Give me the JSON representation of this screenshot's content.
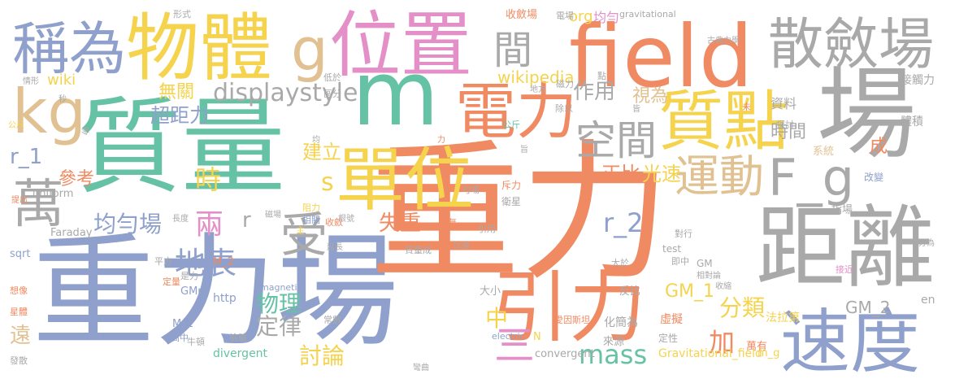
{
  "palette": {
    "salmon": "#f08a62",
    "blue": "#8ea0cb",
    "green": "#66c2a5",
    "yellow": "#f5d34d",
    "pink": "#e48fc7",
    "gray": "#a9a9a9",
    "tan": "#e1c191",
    "lime": "#a6d854"
  },
  "words": [
    {
      "text": "重力場",
      "color": "#8ea0cb"
    },
    {
      "text": "重力",
      "color": "#f08a62"
    },
    {
      "text": "field",
      "color": "#f08a62"
    },
    {
      "text": "質量",
      "color": "#66c2a5"
    },
    {
      "text": "位置",
      "color": "#e48fc7"
    },
    {
      "text": "物體",
      "color": "#f5d34d"
    },
    {
      "text": "稱為",
      "color": "#8ea0cb"
    },
    {
      "text": "m",
      "color": "#66c2a5"
    },
    {
      "text": "單位",
      "color": "#f5d34d"
    },
    {
      "text": "引力",
      "color": "#f08a62"
    },
    {
      "text": "場",
      "color": "#a9a9a9"
    },
    {
      "text": "距離",
      "color": "#a9a9a9"
    },
    {
      "text": "速度",
      "color": "#8ea0cb"
    },
    {
      "text": "散斂場",
      "color": "#a9a9a9"
    },
    {
      "text": "質點",
      "color": "#f5d34d"
    },
    {
      "text": "電力",
      "color": "#f08a62"
    },
    {
      "text": "kg",
      "color": "#e1c191"
    },
    {
      "text": "g",
      "color": "#e1c191"
    },
    {
      "text": "萬",
      "color": "#a9a9a9"
    },
    {
      "text": "間",
      "color": "#a9a9a9"
    },
    {
      "text": "運動",
      "color": "#e1c191"
    },
    {
      "text": "F_g",
      "color": "#a9a9a9"
    },
    {
      "text": "空間",
      "color": "#a9a9a9"
    },
    {
      "text": "受",
      "color": "#a9a9a9"
    },
    {
      "text": "displaystyle",
      "color": "#a9a9a9"
    },
    {
      "text": "作用",
      "color": "#a9a9a9"
    },
    {
      "text": "視為",
      "color": "#e1c191"
    },
    {
      "text": "無關",
      "color": "#f5d34d"
    },
    {
      "text": "超距力",
      "color": "#8ea0cb"
    },
    {
      "text": "時間",
      "color": "#a9a9a9"
    },
    {
      "text": "建立",
      "color": "#f5d34d"
    },
    {
      "text": "均勻場",
      "color": "#8ea0cb"
    },
    {
      "text": "兩",
      "color": "#e48fc7"
    },
    {
      "text": "r",
      "color": "#a9a9a9"
    },
    {
      "text": "s",
      "color": "#f5d34d"
    },
    {
      "text": "失重",
      "color": "#f08a62"
    },
    {
      "text": "正比",
      "color": "#f08a62"
    },
    {
      "text": "光速",
      "color": "#f5d34d"
    },
    {
      "text": "時",
      "color": "#f5d34d"
    },
    {
      "text": "r_2",
      "color": "#8ea0cb"
    },
    {
      "text": "地表",
      "color": "#8ea0cb"
    },
    {
      "text": "物理",
      "color": "#66c2a5"
    },
    {
      "text": "定律",
      "color": "#a9a9a9"
    },
    {
      "text": "分類",
      "color": "#f5d34d"
    },
    {
      "text": "加",
      "color": "#f08a62"
    },
    {
      "text": "三",
      "color": "#e48fc7"
    },
    {
      "text": "中",
      "color": "#f5d34d"
    },
    {
      "text": "討論",
      "color": "#f5d34d"
    },
    {
      "text": "mass",
      "color": "#66c2a5"
    },
    {
      "text": "遠",
      "color": "#e1c191"
    },
    {
      "text": "參考",
      "color": "#f08a62"
    },
    {
      "text": "r_1",
      "color": "#8ea0cb"
    },
    {
      "text": "成",
      "color": "#f08a62"
    },
    {
      "text": "wikipedia",
      "color": "#f5d34d"
    },
    {
      "text": "wiki",
      "color": "#f5d34d"
    },
    {
      "text": "GM_1",
      "color": "#f5d34d"
    },
    {
      "text": "GM_2",
      "color": "#a9a9a9"
    },
    {
      "text": "org",
      "color": "#f5d34d"
    },
    {
      "text": "均勻",
      "color": "#e48fc7"
    },
    {
      "text": "資料",
      "color": "#a9a9a9"
    },
    {
      "text": "接觸力",
      "color": "#a9a9a9"
    },
    {
      "text": "體積",
      "color": "#a9a9a9"
    },
    {
      "text": "系統",
      "color": "#e1c191"
    },
    {
      "text": "指場",
      "color": "#a9a9a9"
    },
    {
      "text": "改變",
      "color": "#8ea0cb"
    },
    {
      "text": "en",
      "color": "#a9a9a9"
    },
    {
      "text": "法拉第",
      "color": "#f5d34d"
    },
    {
      "text": "萬有",
      "color": "#f08a62"
    },
    {
      "text": "虛擬",
      "color": "#f08a62"
    },
    {
      "text": "反比",
      "color": "#a9a9a9"
    },
    {
      "text": "定性",
      "color": "#a9a9a9"
    },
    {
      "text": "來源",
      "color": "#a9a9a9"
    },
    {
      "text": "化簡為",
      "color": "#a9a9a9"
    },
    {
      "text": "大小",
      "color": "#a9a9a9"
    },
    {
      "text": "愛因斯坦",
      "color": "#f08a62"
    },
    {
      "text": "electric",
      "color": "#8ea0cb"
    },
    {
      "text": "N",
      "color": "#f5d34d"
    },
    {
      "text": "convergent",
      "color": "#a9a9a9"
    },
    {
      "text": "Gravitational_field",
      "color": "#f5d34d"
    },
    {
      "text": "m_g",
      "color": "#f5d34d"
    },
    {
      "text": "divergent",
      "color": "#66c2a5"
    },
    {
      "text": "GMm",
      "color": "#8ea0cb"
    },
    {
      "text": "M_1",
      "color": "#8ea0cb"
    },
    {
      "text": "M_2",
      "color": "#f08a62"
    },
    {
      "text": "http",
      "color": "#8ea0cb"
    },
    {
      "text": "magnetic",
      "color": "#8ea0cb"
    },
    {
      "text": "Faraday",
      "color": "#a9a9a9"
    },
    {
      "text": "uniform",
      "color": "#a9a9a9"
    },
    {
      "text": "sqrt",
      "color": "#8ea0cb"
    },
    {
      "text": "test",
      "color": "#a9a9a9"
    },
    {
      "text": "GM",
      "color": "#a9a9a9"
    },
    {
      "text": "gravitational",
      "color": "#a9a9a9"
    },
    {
      "text": "古典力學",
      "color": "#a9a9a9"
    },
    {
      "text": "收斂場",
      "color": "#f08a62"
    },
    {
      "text": "電場",
      "color": "#a9a9a9"
    },
    {
      "text": "形式",
      "color": "#a9a9a9"
    },
    {
      "text": "低於",
      "color": "#a9a9a9"
    },
    {
      "text": "區分",
      "color": "#a9a9a9"
    },
    {
      "text": "磁力",
      "color": "#a9a9a9"
    },
    {
      "text": "地方",
      "color": "#a9a9a9"
    },
    {
      "text": "除以",
      "color": "#a9a9a9"
    },
    {
      "text": "公斤",
      "color": "#66c2a5"
    },
    {
      "text": "皆",
      "color": "#a9a9a9"
    },
    {
      "text": "點",
      "color": "#a9a9a9"
    },
    {
      "text": "未",
      "color": "#f08a62"
    },
    {
      "text": "探討",
      "color": "#a9a9a9"
    },
    {
      "text": "衛星",
      "color": "#a9a9a9"
    },
    {
      "text": "斥力",
      "color": "#f08a62"
    },
    {
      "text": "引用",
      "color": "#a9a9a9"
    },
    {
      "text": "勻場",
      "color": "#a9a9a9"
    },
    {
      "text": "收斂",
      "color": "#f08a62"
    },
    {
      "text": "阻力",
      "color": "#f5d34d"
    },
    {
      "text": "相關",
      "color": "#8ea0cb"
    },
    {
      "text": "主",
      "color": "#f5d34d"
    },
    {
      "text": "磁場",
      "color": "#a9a9a9"
    },
    {
      "text": "根號",
      "color": "#a9a9a9"
    },
    {
      "text": "質量成",
      "color": "#a9a9a9"
    },
    {
      "text": "比值",
      "color": "#a9a9a9"
    },
    {
      "text": "長度",
      "color": "#a9a9a9"
    },
    {
      "text": "延長",
      "color": "#a9a9a9"
    },
    {
      "text": "是力",
      "color": "#a9a9a9"
    },
    {
      "text": "平方",
      "color": "#a9a9a9"
    },
    {
      "text": "定量",
      "color": "#f08a62"
    },
    {
      "text": "大於",
      "color": "#a9a9a9"
    },
    {
      "text": "對行",
      "color": "#a9a9a9"
    },
    {
      "text": "即中",
      "color": "#a9a9a9"
    },
    {
      "text": "相對論",
      "color": "#a9a9a9"
    },
    {
      "text": "收縮",
      "color": "#a9a9a9"
    },
    {
      "text": "接近",
      "color": "#e48fc7"
    },
    {
      "text": "分為",
      "color": "#a9a9a9"
    },
    {
      "text": "常數",
      "color": "#a9a9a9"
    },
    {
      "text": "檢驗",
      "color": "#a9a9a9"
    },
    {
      "text": "牛頓",
      "color": "#a9a9a9"
    },
    {
      "text": "彎曲",
      "color": "#a9a9a9"
    },
    {
      "text": "高中",
      "color": "#8ea0cb"
    },
    {
      "text": "發散",
      "color": "#a9a9a9"
    },
    {
      "text": "星體",
      "color": "#f08a62"
    },
    {
      "text": "想像",
      "color": "#f08a62"
    },
    {
      "text": "提出",
      "color": "#f08a62"
    },
    {
      "text": "公尺",
      "color": "#f5d34d"
    },
    {
      "text": "秒",
      "color": "#a9a9a9"
    },
    {
      "text": "情形",
      "color": "#a9a9a9"
    },
    {
      "text": "零",
      "color": "#a9a9a9"
    },
    {
      "text": "均",
      "color": "#a9a9a9"
    },
    {
      "text": "力",
      "color": "#f08a62"
    },
    {
      "text": "無",
      "color": "#f08a62"
    },
    {
      "text": "旨",
      "color": "#a9a9a9"
    }
  ]
}
